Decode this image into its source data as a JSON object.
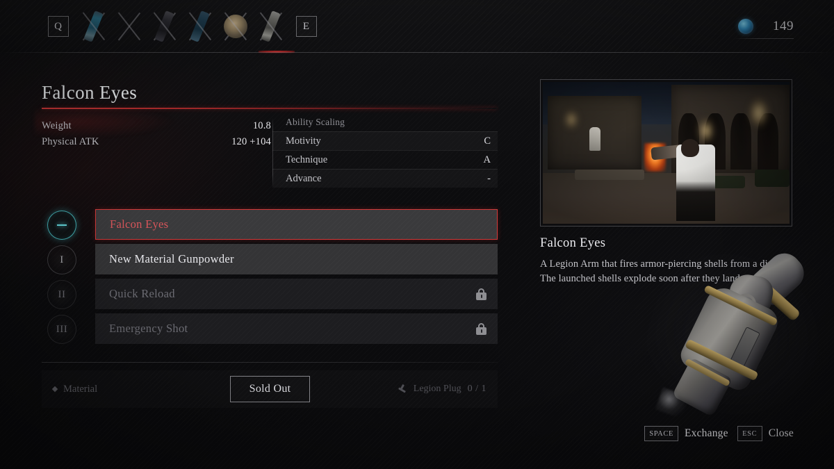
{
  "topbar": {
    "prev_key": "Q",
    "next_key": "E",
    "slots": [
      {
        "name": "weapon-slot-1",
        "selected": false
      },
      {
        "name": "weapon-slot-2",
        "selected": false
      },
      {
        "name": "weapon-slot-3",
        "selected": false
      },
      {
        "name": "weapon-slot-4",
        "selected": false
      },
      {
        "name": "weapon-slot-5",
        "selected": false
      },
      {
        "name": "weapon-slot-6",
        "selected": true
      }
    ],
    "currency": {
      "icon": "ergo-orb-icon",
      "amount": "149"
    }
  },
  "item": {
    "title": "Falcon Eyes",
    "stats": [
      {
        "label": "Weight",
        "value": "10.8"
      },
      {
        "label": "Physical ATK",
        "value": "120 +104"
      }
    ],
    "scaling": {
      "header": "Ability Scaling",
      "rows": [
        {
          "label": "Motivity",
          "grade": "C"
        },
        {
          "label": "Technique",
          "grade": "A"
        },
        {
          "label": "Advance",
          "grade": "-"
        }
      ]
    }
  },
  "abilities": [
    {
      "badge": "—",
      "name": "Falcon Eyes",
      "state": "selected",
      "locked": false
    },
    {
      "badge": "I",
      "name": "New Material Gunpowder",
      "state": "available",
      "locked": false
    },
    {
      "badge": "II",
      "name": "Quick Reload",
      "state": "locked",
      "locked": true
    },
    {
      "badge": "III",
      "name": "Emergency Shot",
      "state": "locked",
      "locked": true
    }
  ],
  "bottombar": {
    "material_label": "Material",
    "action_label": "Sold Out",
    "legion_plug_label": "Legion Plug",
    "legion_plug_count": "0 / 1"
  },
  "detail": {
    "preview_alt": "gameplay-preview",
    "title": "Falcon Eyes",
    "description": "A Legion Arm that fires armor-piercing shells from a distance. The launched shells explode soon after they land."
  },
  "hints": [
    {
      "key": "SPACE",
      "action": "Exchange"
    },
    {
      "key": "ESC",
      "action": "Close"
    }
  ],
  "colors": {
    "accent_red": "#d23a3a",
    "accent_teal": "#67dde2",
    "text_primary": "#ececf0",
    "text_dim": "#6d6d74"
  }
}
